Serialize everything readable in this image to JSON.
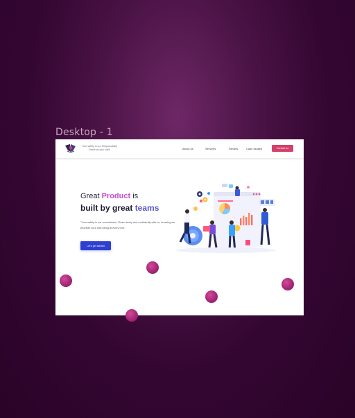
{
  "frame": {
    "label": "Desktop - 1"
  },
  "header": {
    "tagline_line1": "Your safety is our Responsibility",
    "tagline_line2": "Brave as your walk",
    "nav": [
      "About us",
      "Services",
      "Review",
      "Case studies"
    ],
    "contact_label": "Contact us"
  },
  "hero": {
    "line1_prefix": "Great ",
    "line1_accent": "Product",
    "line1_suffix": " is",
    "line2_prefix": "built by great ",
    "line2_accent": "teams",
    "description": "\"Your safety is our commitment. Roam freely and confidently with us, knowing we prioritize your well-being at every turn.\"",
    "cta_label": "Let's get started"
  },
  "colors": {
    "brand_pink": "#d43f6c",
    "accent_purple": "#c44bd0",
    "accent_blue": "#5a57c9",
    "cta_blue": "#2f3fd0"
  },
  "icons": [
    "logo-icon",
    "team-illustration",
    "decorative-sphere"
  ]
}
